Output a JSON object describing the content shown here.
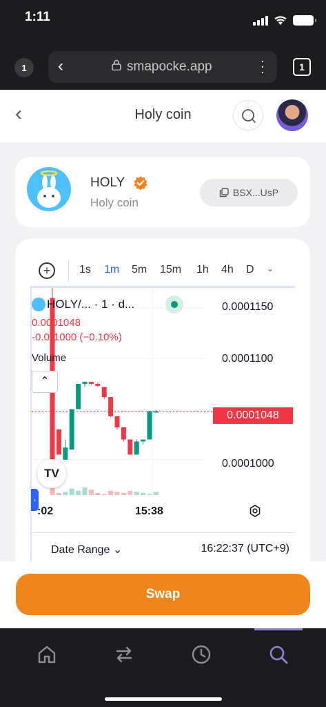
{
  "status_bar": {
    "time": "1:11"
  },
  "browser": {
    "tab_count_left": "1",
    "url": "smapocke.app",
    "tab_count_right": "1"
  },
  "header": {
    "title": "Holy coin"
  },
  "token": {
    "symbol": "HOLY",
    "name": "Holy coin",
    "address_short": "BSX...UsP",
    "verified_color": "#f5821f"
  },
  "chart_toolbar": {
    "timeframes": [
      "1s",
      "1m",
      "5m",
      "15m",
      "1h",
      "4h",
      "D"
    ],
    "active_timeframe": "1m"
  },
  "chart_legend": {
    "title": "HOLY/... · 1 · d...",
    "price": "0.0001048",
    "change": "-0.0₆1000 (−0.10%)",
    "volume_label": "Volume"
  },
  "chart_data": {
    "type": "candlestick",
    "y_tick_labels": [
      "0.0001150",
      "0.0001100",
      "0.0001000"
    ],
    "ylim": [
      9.65e-05,
      0.000117
    ],
    "x_tick_labels": [
      ":02",
      "15:38"
    ],
    "current_price_label": "0.0001048",
    "up_color": "#089981",
    "down_color": "#f23645",
    "candles": [
      {
        "o": 0.000116,
        "h": 0.000117,
        "l": 9.85e-05,
        "c": 9.85e-05
      },
      {
        "o": 0.000103,
        "h": 0.000103,
        "l": 0.0001005,
        "c": 0.0001005
      },
      {
        "o": 0.0001,
        "h": 0.000102,
        "l": 0.0001,
        "c": 0.0001012
      },
      {
        "o": 0.000101,
        "h": 0.000105,
        "l": 0.000101,
        "c": 0.000105
      },
      {
        "o": 0.000105,
        "h": 0.0001075,
        "l": 0.000105,
        "c": 0.0001075
      },
      {
        "o": 0.0001075,
        "h": 0.0001077,
        "l": 0.0001072,
        "c": 0.0001077
      },
      {
        "o": 0.0001077,
        "h": 0.0001077,
        "l": 0.0001074,
        "c": 0.0001075
      },
      {
        "o": 0.0001075,
        "h": 0.0001076,
        "l": 0.0001072,
        "c": 0.0001073
      },
      {
        "o": 0.0001072,
        "h": 0.0001072,
        "l": 0.000106,
        "c": 0.0001062
      },
      {
        "o": 0.0001062,
        "h": 0.0001062,
        "l": 0.0001042,
        "c": 0.0001043
      },
      {
        "o": 0.0001043,
        "h": 0.0001043,
        "l": 0.000103,
        "c": 0.0001032
      },
      {
        "o": 0.0001032,
        "h": 0.0001032,
        "l": 0.0001018,
        "c": 0.000102
      },
      {
        "o": 0.000102,
        "h": 0.000102,
        "l": 0.0001005,
        "c": 0.0001005
      },
      {
        "o": 0.0001005,
        "h": 0.000102,
        "l": 0.0001005,
        "c": 0.0001018
      },
      {
        "o": 0.0001018,
        "h": 0.000102,
        "l": 0.0001015,
        "c": 0.000102
      },
      {
        "o": 0.000102,
        "h": 0.0001048,
        "l": 0.000102,
        "c": 0.0001048
      },
      {
        "o": 0.0001048,
        "h": 0.0001049,
        "l": 0.0001047,
        "c": 0.0001048
      }
    ],
    "volumes": [
      9,
      2,
      3,
      6,
      4,
      7,
      5,
      2,
      1,
      4,
      3,
      2,
      4,
      3,
      2,
      1,
      3
    ]
  },
  "chart_footer": {
    "date_range_label": "Date Range",
    "timestamp": "16:22:37 (UTC+9)"
  },
  "actions": {
    "swap_label": "Swap"
  },
  "bottom_nav": {
    "items": [
      "home-icon",
      "swap-arrows-icon",
      "history-icon",
      "search-icon"
    ],
    "active_color": "#8f82d8",
    "inactive_color": "#8e8e93"
  }
}
